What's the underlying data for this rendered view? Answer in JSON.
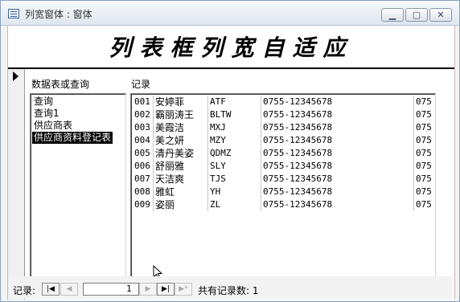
{
  "window": {
    "title": "列宽窗体 : 窗体"
  },
  "form": {
    "header_title": "列表框列宽自适应",
    "left_label": "数据表或查询",
    "right_label": "记录"
  },
  "source_list": {
    "items": [
      "查询",
      "查询1",
      "供应商表",
      "供应商资料登记表"
    ],
    "selected_index": 3
  },
  "records": [
    {
      "id": "001",
      "name": "安婷菲",
      "code": "ATF",
      "phone": "0755-12345678",
      "extra": "075"
    },
    {
      "id": "002",
      "name": "霸丽涛王",
      "code": "BLTW",
      "phone": "0755-12345678",
      "extra": "075"
    },
    {
      "id": "003",
      "name": "美霞洁",
      "code": "MXJ",
      "phone": "0755-12345678",
      "extra": "075"
    },
    {
      "id": "004",
      "name": "美之妍",
      "code": "MZY",
      "phone": "0755-12345678",
      "extra": "075"
    },
    {
      "id": "005",
      "name": "清丹美姿",
      "code": "QDMZ",
      "phone": "0755-12345678",
      "extra": "075"
    },
    {
      "id": "006",
      "name": "舒丽雅",
      "code": "SLY",
      "phone": "0755-12345678",
      "extra": "075"
    },
    {
      "id": "007",
      "name": "天洁爽",
      "code": "TJS",
      "phone": "0755-12345678",
      "extra": "075"
    },
    {
      "id": "008",
      "name": "雅虹",
      "code": "YH",
      "phone": "0755-12345678",
      "extra": "075"
    },
    {
      "id": "009",
      "name": "姿丽",
      "code": "ZL",
      "phone": "0755-12345678",
      "extra": "075"
    }
  ],
  "navigation": {
    "label": "记录:",
    "current": "1",
    "total_text": "共有记录数: 1"
  },
  "icons": {
    "minimize": "minimize-icon",
    "maximize": "maximize-icon",
    "close": "close-icon",
    "first": "first-record-icon",
    "prev": "previous-record-icon",
    "next": "next-record-icon",
    "last": "last-record-icon",
    "new": "new-record-icon"
  },
  "colors": {
    "selection": "#000000",
    "selection_text": "#ffffff"
  }
}
